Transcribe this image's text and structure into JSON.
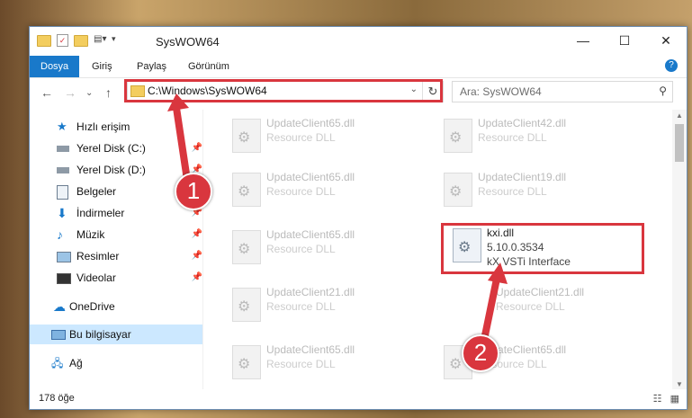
{
  "window": {
    "title": "SysWOW64",
    "controls": [
      "minimize",
      "maximize",
      "close"
    ]
  },
  "ribbon": {
    "tabs": [
      "Dosya",
      "Giriş",
      "Paylaş",
      "Görünüm"
    ],
    "active_tab": "Dosya",
    "help_label": "?"
  },
  "address": {
    "path": "C:\\Windows\\SysWOW64",
    "refresh_icon": "refresh-icon"
  },
  "search": {
    "placeholder": "Ara: SysWOW64"
  },
  "sidebar": {
    "items": [
      {
        "label": "Hızlı erişim",
        "icon": "star-icon",
        "pinned": false
      },
      {
        "label": "Yerel Disk (C:)",
        "icon": "drive-icon",
        "pinned": true
      },
      {
        "label": "Yerel Disk (D:)",
        "icon": "drive-icon",
        "pinned": true
      },
      {
        "label": "Belgeler",
        "icon": "documents-icon",
        "pinned": true
      },
      {
        "label": "İndirmeler",
        "icon": "download-icon",
        "pinned": true
      },
      {
        "label": "Müzik",
        "icon": "music-icon",
        "pinned": true
      },
      {
        "label": "Resimler",
        "icon": "pictures-icon",
        "pinned": true
      },
      {
        "label": "Videolar",
        "icon": "video-icon",
        "pinned": true
      },
      {
        "label": "OneDrive",
        "icon": "cloud-icon",
        "pinned": false
      },
      {
        "label": "Bu bilgisayar",
        "icon": "computer-icon",
        "pinned": false,
        "selected": true
      },
      {
        "label": "Ağ",
        "icon": "network-icon",
        "pinned": false
      }
    ]
  },
  "files": [
    {
      "name": "UpdateClient65.dll",
      "type": "Resource DLL"
    },
    {
      "name": "UpdateClient42.dll",
      "type": "Resource DLL"
    },
    {
      "name": "UpdateClient65.dll",
      "type": "Resource DLL"
    },
    {
      "name": "UpdateClient19.dll",
      "type": "Resource DLL"
    },
    {
      "name": "UpdateClient65.dll",
      "type": "Resource DLL"
    },
    {
      "name": "kxi.dll",
      "type": "5.10.0.3534",
      "desc": "kX VSTi Interface",
      "highlighted": true
    },
    {
      "name": "UpdateClient21.dll",
      "type": "Resource DLL"
    },
    {
      "name": "UpdateClient21.dll",
      "type": "Resource DLL"
    },
    {
      "name": "UpdateClient65.dll",
      "type": "Resource DLL"
    },
    {
      "name": "UpdateClient65.dll",
      "type": "Resource DLL"
    }
  ],
  "status": {
    "item_count": "178 öğe"
  },
  "callouts": [
    "1",
    "2"
  ],
  "colors": {
    "accent": "#1979ca",
    "highlight_red": "#d9363e",
    "selection": "#cce8ff"
  }
}
